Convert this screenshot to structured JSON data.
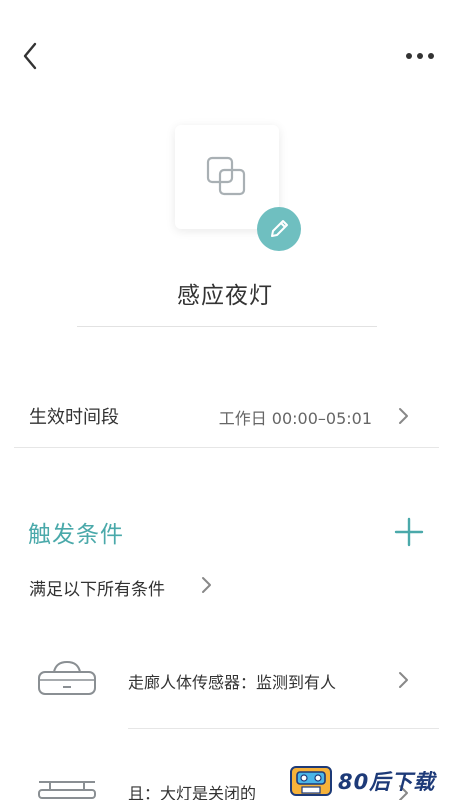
{
  "topbar": {
    "back_icon": "chevron-left-icon",
    "more_icon": "more-horizontal-icon"
  },
  "scene": {
    "icon": "scene-overlap-squares-icon",
    "edit_icon": "pencil-icon",
    "name": "感应夜灯"
  },
  "effective_time": {
    "label": "生效时间段",
    "value": "工作日 00:00–05:01"
  },
  "triggers": {
    "title": "触发条件",
    "add_icon": "plus-icon",
    "mode_label": "满足以下所有条件",
    "accent_color": "#4aa9aa",
    "items": [
      {
        "icon": "motion-sensor-icon",
        "text": "走廊人体传感器：监测到有人"
      },
      {
        "icon": "ceiling-light-icon",
        "text": "且：大灯是关闭的"
      }
    ]
  },
  "watermark": {
    "text": "80后下载"
  },
  "colors": {
    "badge": "#6fbfc0",
    "accent": "#4aa9aa",
    "text": "#333333",
    "secondary": "#666666"
  }
}
